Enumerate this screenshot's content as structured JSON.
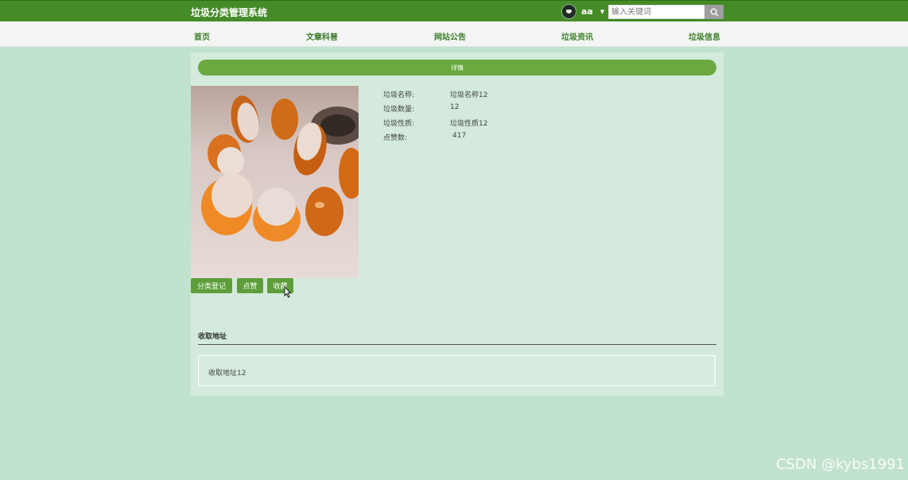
{
  "header": {
    "site_title": "垃圾分类管理系统",
    "username": "aa",
    "search_placeholder": "输入关键词"
  },
  "nav": {
    "items": [
      {
        "label": "首页"
      },
      {
        "label": "文章科普"
      },
      {
        "label": "网站公告"
      },
      {
        "label": "垃圾资讯"
      },
      {
        "label": "垃圾信息"
      }
    ]
  },
  "detail": {
    "banner": "详情",
    "fields": [
      {
        "label": "垃圾名称:",
        "value": "垃圾名称12"
      },
      {
        "label": "垃圾数量:",
        "value": "12"
      },
      {
        "label": "垃圾性质:",
        "value": "垃圾性质12"
      },
      {
        "label": "点赞数:",
        "value": "417"
      }
    ],
    "buttons": {
      "register": "分类登记",
      "like": "点赞",
      "favorite": "收藏"
    }
  },
  "address": {
    "title": "收取地址",
    "value": "收取地址12"
  },
  "watermark": "CSDN @kybs1991",
  "colors": {
    "topbar": "#458c28",
    "background": "#c1e2cd",
    "panel": "#d3eadd",
    "banner": "#6aa93f",
    "button": "#5d9e3a"
  }
}
